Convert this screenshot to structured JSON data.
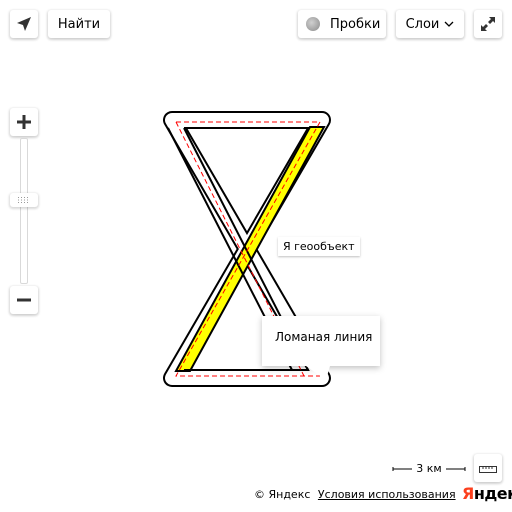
{
  "map": {
    "polyline_colors": {
      "fill": "#ffff00",
      "stroke": "#000000",
      "dash": "#ff0000"
    },
    "hint_text": "Я геообъект",
    "balloon_text": "Ломаная линия"
  },
  "controls": {
    "geolocation_icon": "location-arrow-icon",
    "search_label": "Найти",
    "traffic_label": "Пробки",
    "layers_label": "Слои",
    "fullscreen_icon": "expand-icon",
    "zoom_in_icon": "plus-icon",
    "zoom_out_icon": "minus-icon",
    "ruler_icon": "ruler-icon"
  },
  "scale_label": "3 км",
  "copyright": {
    "text": "© Яндекс",
    "terms_link": "Условия использования"
  },
  "logo": {
    "first": "Я",
    "rest": "ндекс"
  }
}
